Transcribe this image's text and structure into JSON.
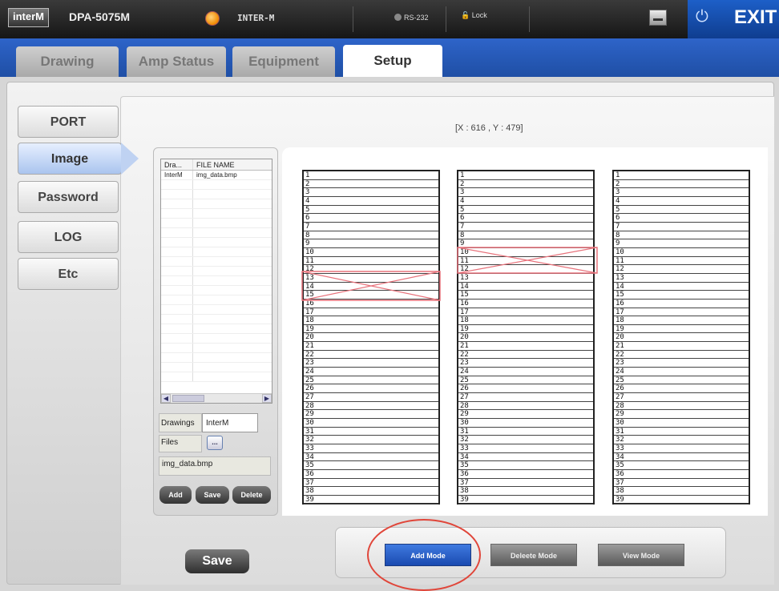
{
  "topbar": {
    "brand": "interM",
    "model": "DPA-5075M",
    "device_name": "INTER-M",
    "rs232": "RS-232",
    "lock": "Lock",
    "exit": "EXIT"
  },
  "tabs": [
    {
      "label": "Drawing"
    },
    {
      "label": "Amp Status"
    },
    {
      "label": "Equipment"
    },
    {
      "label": "Setup",
      "active": true
    }
  ],
  "sidebar": {
    "items": [
      {
        "label": "PORT"
      },
      {
        "label": "Image",
        "active": true
      },
      {
        "label": "Password"
      },
      {
        "label": "LOG"
      },
      {
        "label": "Etc"
      }
    ]
  },
  "coords": "[X : 616 , Y : 479]",
  "file_list": {
    "headers": [
      "Dra...",
      "FILE NAME"
    ],
    "rows": [
      [
        "InterM",
        "img_data.bmp"
      ]
    ]
  },
  "form": {
    "drawings_label": "Drawings",
    "drawings_value": "InterM",
    "files_label": "Files",
    "browse_label": "...",
    "file_value": "img_data.bmp"
  },
  "buttons": {
    "add": "Add",
    "save_small": "Save",
    "delete": "Delete",
    "save": "Save"
  },
  "modes": {
    "add": "Add Mode",
    "delete": "Deleete Mode",
    "view": "View Mode",
    "active": "Add Mode"
  },
  "columns": {
    "row_count": 39,
    "crossed": [
      {
        "column": 1,
        "rows": [
          13,
          15
        ]
      },
      {
        "column": 2,
        "rows": [
          10,
          12
        ]
      }
    ]
  },
  "colors": {
    "accent_blue": "#2e64c9",
    "highlight_red": "#e8737c",
    "annotation_red": "#e0463a"
  }
}
